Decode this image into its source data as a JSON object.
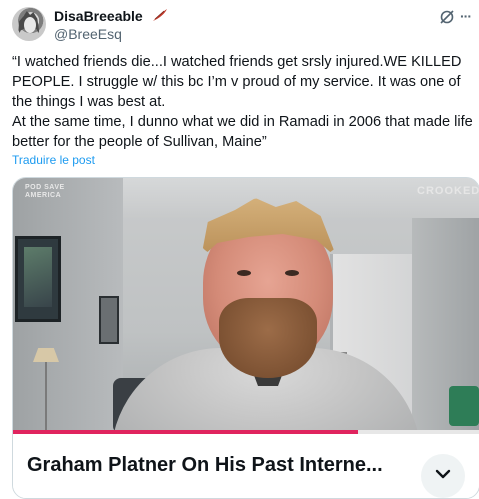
{
  "author": {
    "display_name": "DisaBreeable",
    "handle": "@BreeEsq",
    "name_badge_icon": "feather-icon"
  },
  "header_actions": {
    "grok_icon": "grok-icon",
    "more_icon": "more-icon",
    "more_label": "···"
  },
  "tweet": {
    "paragraph_1": "“I watched friends die...I watched friends get srsly injured.WE KILLED PEOPLE. I struggle w/ this bc I’m v proud of my service. It was one of the things I was best at.",
    "paragraph_2": "At the same time, I dunno what we did in Ramadi in 2006 that made life better for the people of Sullivan, Maine”",
    "translate_label": "Traduire le post"
  },
  "media": {
    "watermark_left_line1": "POD SAVE",
    "watermark_left_line2": "AMERICA",
    "watermark_right": "CROOKED",
    "progress": 0.74,
    "progress_color": "#e0245e",
    "card_title": "Graham Platner On His Past Interne...",
    "expand_icon": "chevron-down-icon"
  },
  "colors": {
    "link": "#1d9bf0",
    "secondary_text": "#536471",
    "primary_text": "#0f1419"
  }
}
